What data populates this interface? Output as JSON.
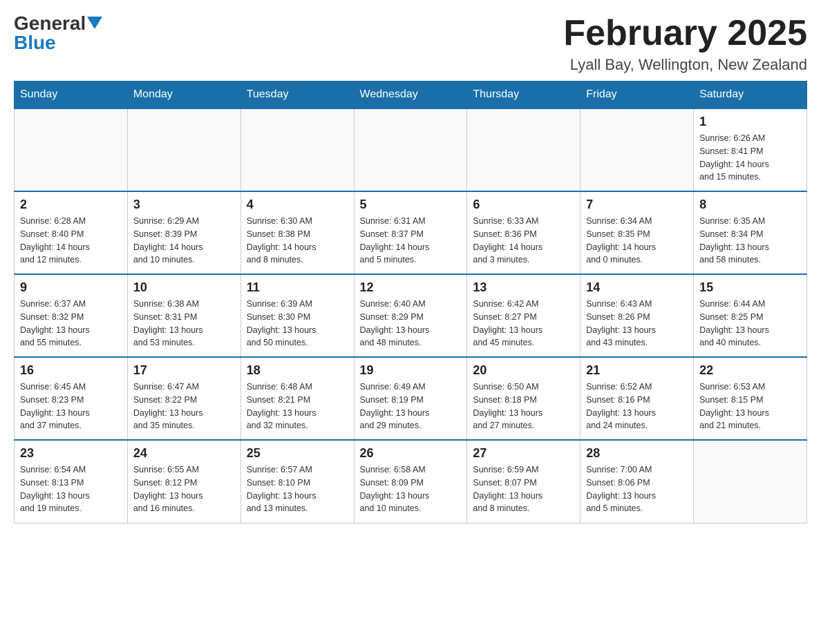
{
  "header": {
    "logo_general": "General",
    "logo_blue": "Blue",
    "title": "February 2025",
    "subtitle": "Lyall Bay, Wellington, New Zealand"
  },
  "weekdays": [
    "Sunday",
    "Monday",
    "Tuesday",
    "Wednesday",
    "Thursday",
    "Friday",
    "Saturday"
  ],
  "weeks": [
    [
      {
        "day": "",
        "info": ""
      },
      {
        "day": "",
        "info": ""
      },
      {
        "day": "",
        "info": ""
      },
      {
        "day": "",
        "info": ""
      },
      {
        "day": "",
        "info": ""
      },
      {
        "day": "",
        "info": ""
      },
      {
        "day": "1",
        "info": "Sunrise: 6:26 AM\nSunset: 8:41 PM\nDaylight: 14 hours\nand 15 minutes."
      }
    ],
    [
      {
        "day": "2",
        "info": "Sunrise: 6:28 AM\nSunset: 8:40 PM\nDaylight: 14 hours\nand 12 minutes."
      },
      {
        "day": "3",
        "info": "Sunrise: 6:29 AM\nSunset: 8:39 PM\nDaylight: 14 hours\nand 10 minutes."
      },
      {
        "day": "4",
        "info": "Sunrise: 6:30 AM\nSunset: 8:38 PM\nDaylight: 14 hours\nand 8 minutes."
      },
      {
        "day": "5",
        "info": "Sunrise: 6:31 AM\nSunset: 8:37 PM\nDaylight: 14 hours\nand 5 minutes."
      },
      {
        "day": "6",
        "info": "Sunrise: 6:33 AM\nSunset: 8:36 PM\nDaylight: 14 hours\nand 3 minutes."
      },
      {
        "day": "7",
        "info": "Sunrise: 6:34 AM\nSunset: 8:35 PM\nDaylight: 14 hours\nand 0 minutes."
      },
      {
        "day": "8",
        "info": "Sunrise: 6:35 AM\nSunset: 8:34 PM\nDaylight: 13 hours\nand 58 minutes."
      }
    ],
    [
      {
        "day": "9",
        "info": "Sunrise: 6:37 AM\nSunset: 8:32 PM\nDaylight: 13 hours\nand 55 minutes."
      },
      {
        "day": "10",
        "info": "Sunrise: 6:38 AM\nSunset: 8:31 PM\nDaylight: 13 hours\nand 53 minutes."
      },
      {
        "day": "11",
        "info": "Sunrise: 6:39 AM\nSunset: 8:30 PM\nDaylight: 13 hours\nand 50 minutes."
      },
      {
        "day": "12",
        "info": "Sunrise: 6:40 AM\nSunset: 8:29 PM\nDaylight: 13 hours\nand 48 minutes."
      },
      {
        "day": "13",
        "info": "Sunrise: 6:42 AM\nSunset: 8:27 PM\nDaylight: 13 hours\nand 45 minutes."
      },
      {
        "day": "14",
        "info": "Sunrise: 6:43 AM\nSunset: 8:26 PM\nDaylight: 13 hours\nand 43 minutes."
      },
      {
        "day": "15",
        "info": "Sunrise: 6:44 AM\nSunset: 8:25 PM\nDaylight: 13 hours\nand 40 minutes."
      }
    ],
    [
      {
        "day": "16",
        "info": "Sunrise: 6:45 AM\nSunset: 8:23 PM\nDaylight: 13 hours\nand 37 minutes."
      },
      {
        "day": "17",
        "info": "Sunrise: 6:47 AM\nSunset: 8:22 PM\nDaylight: 13 hours\nand 35 minutes."
      },
      {
        "day": "18",
        "info": "Sunrise: 6:48 AM\nSunset: 8:21 PM\nDaylight: 13 hours\nand 32 minutes."
      },
      {
        "day": "19",
        "info": "Sunrise: 6:49 AM\nSunset: 8:19 PM\nDaylight: 13 hours\nand 29 minutes."
      },
      {
        "day": "20",
        "info": "Sunrise: 6:50 AM\nSunset: 8:18 PM\nDaylight: 13 hours\nand 27 minutes."
      },
      {
        "day": "21",
        "info": "Sunrise: 6:52 AM\nSunset: 8:16 PM\nDaylight: 13 hours\nand 24 minutes."
      },
      {
        "day": "22",
        "info": "Sunrise: 6:53 AM\nSunset: 8:15 PM\nDaylight: 13 hours\nand 21 minutes."
      }
    ],
    [
      {
        "day": "23",
        "info": "Sunrise: 6:54 AM\nSunset: 8:13 PM\nDaylight: 13 hours\nand 19 minutes."
      },
      {
        "day": "24",
        "info": "Sunrise: 6:55 AM\nSunset: 8:12 PM\nDaylight: 13 hours\nand 16 minutes."
      },
      {
        "day": "25",
        "info": "Sunrise: 6:57 AM\nSunset: 8:10 PM\nDaylight: 13 hours\nand 13 minutes."
      },
      {
        "day": "26",
        "info": "Sunrise: 6:58 AM\nSunset: 8:09 PM\nDaylight: 13 hours\nand 10 minutes."
      },
      {
        "day": "27",
        "info": "Sunrise: 6:59 AM\nSunset: 8:07 PM\nDaylight: 13 hours\nand 8 minutes."
      },
      {
        "day": "28",
        "info": "Sunrise: 7:00 AM\nSunset: 8:06 PM\nDaylight: 13 hours\nand 5 minutes."
      },
      {
        "day": "",
        "info": ""
      }
    ]
  ]
}
